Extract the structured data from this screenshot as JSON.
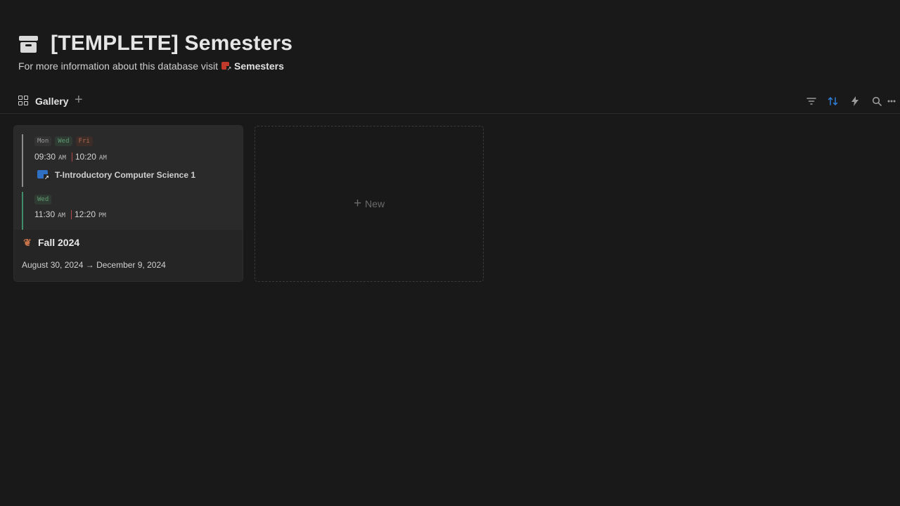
{
  "header": {
    "title": "[TEMPLETE] Semesters",
    "subtitle_prefix": "For more information about this database visit",
    "subtitle_link": "Semesters",
    "title_icon": "archive-box-icon"
  },
  "view_bar": {
    "tab_label": "Gallery",
    "tab_icon": "gallery-grid-icon",
    "add_view_label": "+",
    "toolbar": {
      "filter_icon": "filter-icon",
      "sort_icon": "sort-icon",
      "automation_icon": "lightning-icon",
      "search_icon": "search-icon",
      "more_icon": "more-icon",
      "sort_active_color": "#2e7fd8"
    }
  },
  "gallery": {
    "cards": [
      {
        "title": "Fall 2024",
        "dates": "August 30, 2024 → December 9, 2024",
        "icon": "leaf-icon",
        "schedule": [
          {
            "days": [
              "Mon",
              "Wed",
              "Fri"
            ],
            "start": "09:30",
            "start_ampm": "AM",
            "end": "10:20",
            "end_ampm": "AM",
            "course": "T-Introductory Computer Science 1",
            "bar_color": "#8c8c8c"
          },
          {
            "days": [
              "Wed"
            ],
            "start": "11:30",
            "start_ampm": "AM",
            "end": "12:20",
            "end_ampm": "PM",
            "bar_color": "#3f8f6a"
          }
        ]
      }
    ],
    "new_label": "New"
  }
}
